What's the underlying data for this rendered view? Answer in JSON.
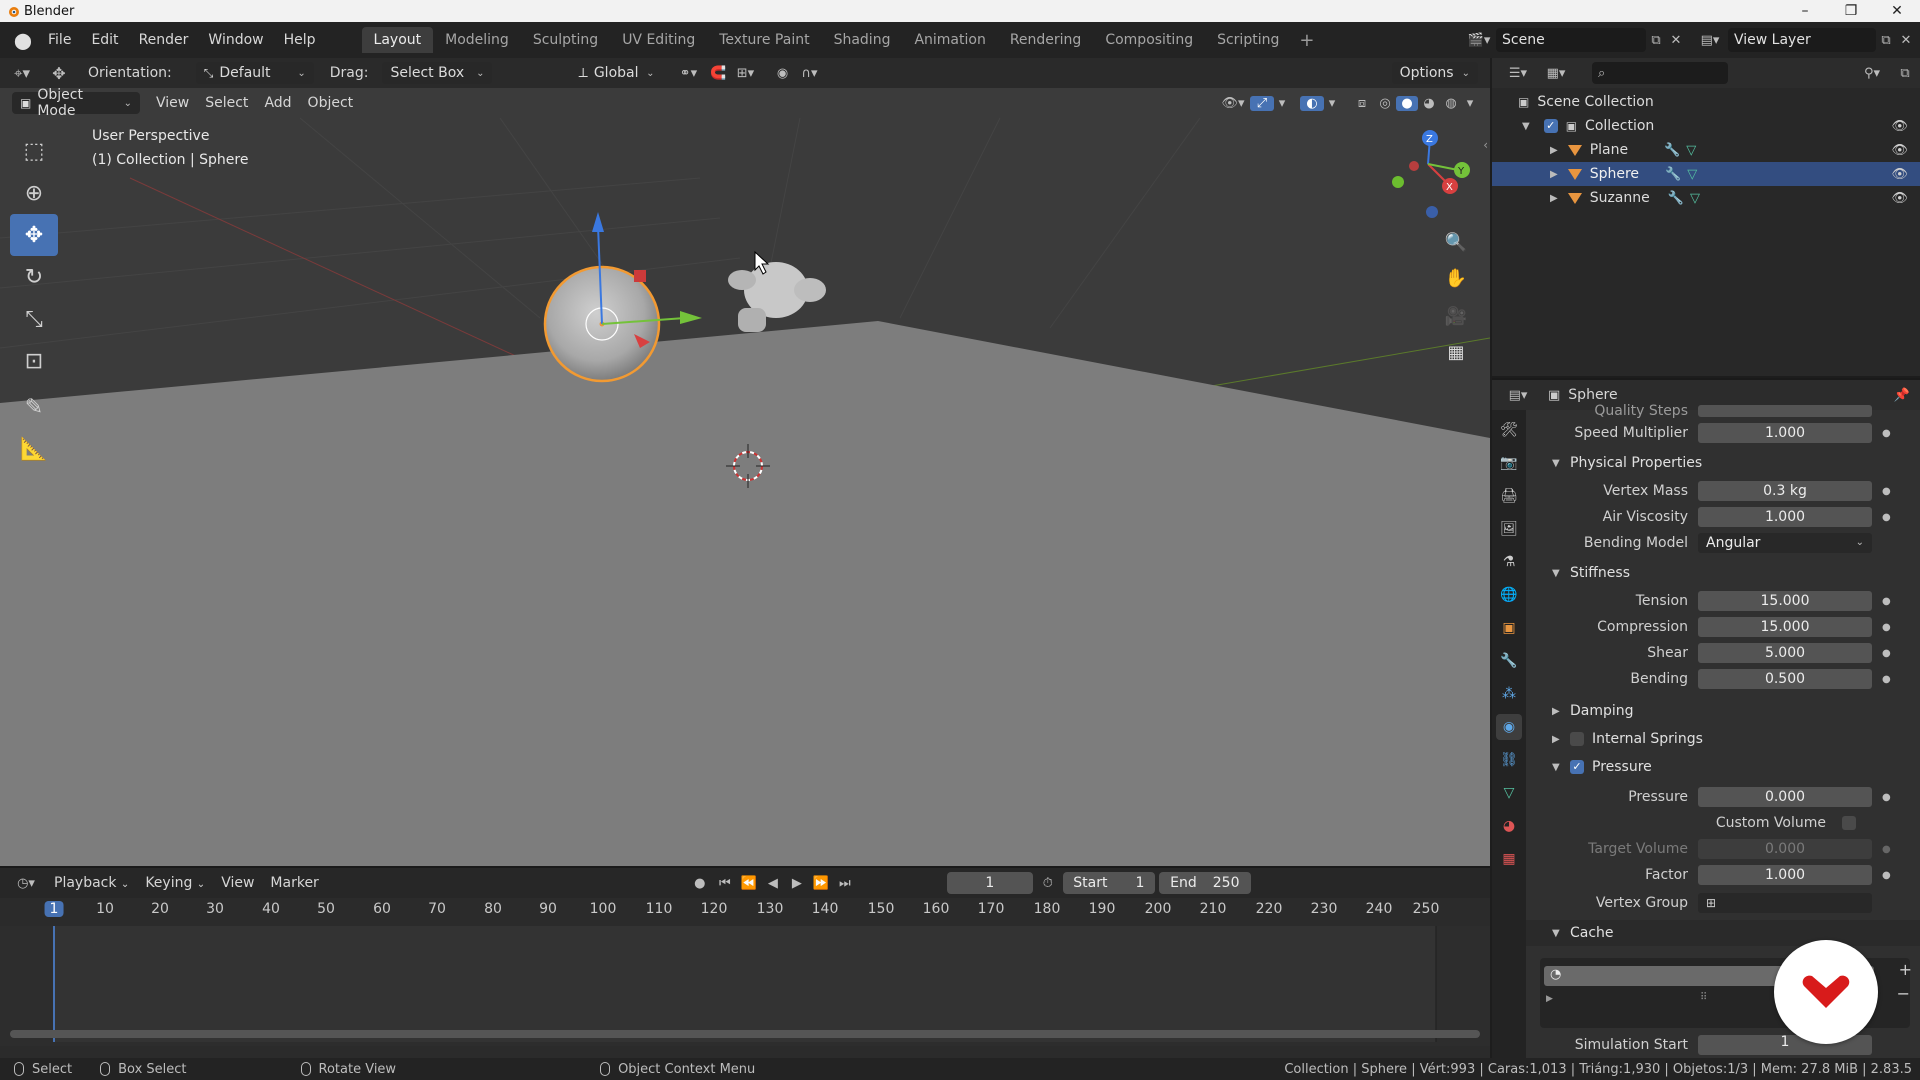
{
  "window": {
    "title": "Blender",
    "controls": [
      "–",
      "❐",
      "✕"
    ]
  },
  "menubar": {
    "menus": [
      "File",
      "Edit",
      "Render",
      "Window",
      "Help"
    ],
    "workspaces": [
      "Layout",
      "Modeling",
      "Sculpting",
      "UV Editing",
      "Texture Paint",
      "Shading",
      "Animation",
      "Rendering",
      "Compositing",
      "Scripting"
    ],
    "active_workspace": "Layout",
    "add_workspace": "+",
    "scene": "Scene",
    "view_layer": "View Layer"
  },
  "viewport": {
    "header": {
      "orientation_label": "Orientation:",
      "orientation_value": "Default",
      "drag_label": "Drag:",
      "drag_value": "Select Box",
      "transform_orientation": "Global",
      "options": "Options"
    },
    "mode": "Object Mode",
    "menus": [
      "View",
      "Select",
      "Add",
      "Object"
    ],
    "perspective_label": "User Perspective",
    "collection_label": "(1) Collection | Sphere",
    "gizmo_axes": {
      "x": "X",
      "y": "Y",
      "z": "Z"
    },
    "accent_color": "#4772b3",
    "selection_outline_color": "#f29a32"
  },
  "timeline": {
    "menus": [
      "Playback",
      "Keying",
      "View",
      "Marker"
    ],
    "current_frame": "1",
    "start_label": "Start",
    "start_value": "1",
    "end_label": "End",
    "end_value": "250",
    "ruler": [
      "1",
      "10",
      "20",
      "30",
      "40",
      "50",
      "60",
      "70",
      "80",
      "90",
      "100",
      "110",
      "120",
      "130",
      "140",
      "150",
      "160",
      "170",
      "180",
      "190",
      "200",
      "210",
      "220",
      "230",
      "240",
      "250"
    ]
  },
  "outliner": {
    "root": "Scene Collection",
    "collection": "Collection",
    "objects": [
      {
        "name": "Plane",
        "selected": false
      },
      {
        "name": "Sphere",
        "selected": true
      },
      {
        "name": "Suzanne",
        "selected": false
      }
    ]
  },
  "properties": {
    "object_name": "Sphere",
    "cut_row_label": "Quality Steps",
    "speed_multiplier": {
      "label": "Speed Multiplier",
      "value": "1.000"
    },
    "physical": {
      "title": "Physical Properties",
      "vertex_mass": {
        "label": "Vertex Mass",
        "value": "0.3 kg"
      },
      "air_viscosity": {
        "label": "Air Viscosity",
        "value": "1.000"
      },
      "bending_model": {
        "label": "Bending Model",
        "value": "Angular"
      }
    },
    "stiffness": {
      "title": "Stiffness",
      "tension": {
        "label": "Tension",
        "value": "15.000"
      },
      "compression": {
        "label": "Compression",
        "value": "15.000"
      },
      "shear": {
        "label": "Shear",
        "value": "5.000"
      },
      "bending": {
        "label": "Bending",
        "value": "0.500"
      }
    },
    "damping": {
      "title": "Damping"
    },
    "internal_springs": {
      "title": "Internal Springs"
    },
    "pressure": {
      "title": "Pressure",
      "pressure": {
        "label": "Pressure",
        "value": "0.000"
      },
      "custom_volume": {
        "label": "Custom Volume"
      },
      "target_volume": {
        "label": "Target Volume",
        "value": "0.000"
      },
      "factor": {
        "label": "Factor",
        "value": "1.000"
      },
      "vertex_group": {
        "label": "Vertex Group"
      }
    },
    "cache": {
      "title": "Cache",
      "cut_row_label": "Simulation Start",
      "cut_row_value": "1"
    }
  },
  "statusbar": {
    "select": "Select",
    "box_select": "Box Select",
    "rotate_view": "Rotate View",
    "context_menu": "Object Context Menu",
    "info": "Collection | Sphere | Vért:993 | Caras:1,013 | Triáng:1,930 | Objetos:1/3 | Mem: 27.8 MiB | 2.83.5"
  }
}
